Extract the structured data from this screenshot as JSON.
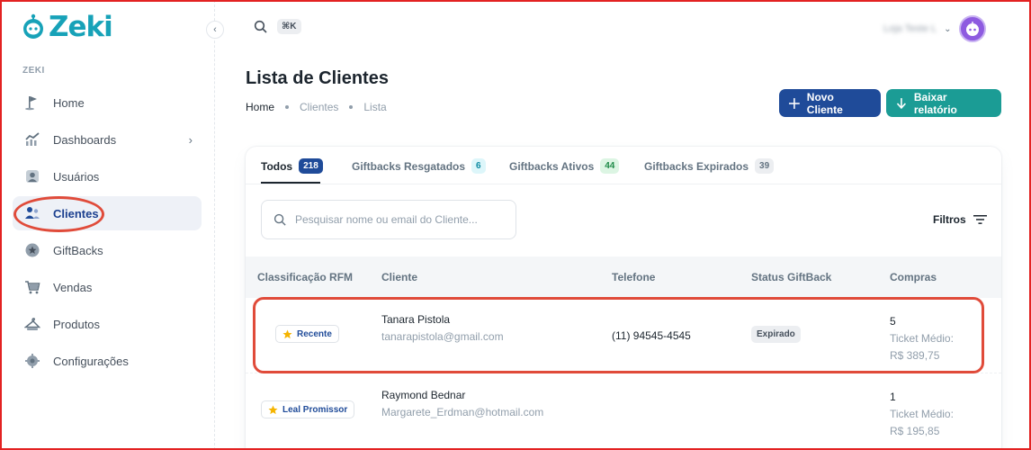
{
  "brand": {
    "name": "Zeki",
    "color": "#17a2b8"
  },
  "sidebar": {
    "section_label": "ZEKI",
    "items": [
      {
        "label": "Home",
        "icon": "flag-icon"
      },
      {
        "label": "Dashboards",
        "icon": "chart-line-icon"
      },
      {
        "label": "Usuários",
        "icon": "user-icon"
      },
      {
        "label": "Clientes",
        "icon": "clients-icon"
      },
      {
        "label": "GiftBacks",
        "icon": "star-badge-icon"
      },
      {
        "label": "Vendas",
        "icon": "cart-icon"
      },
      {
        "label": "Produtos",
        "icon": "hanger-icon"
      },
      {
        "label": "Configurações",
        "icon": "gear-icon"
      }
    ]
  },
  "header": {
    "search_shortcut": "⌘K",
    "account_name": "Loja Teste L"
  },
  "page": {
    "title": "Lista de Clientes",
    "breadcrumb": [
      "Home",
      "Clientes",
      "Lista"
    ],
    "buttons": {
      "new_client": "Novo Cliente",
      "download_report": "Baixar relatório"
    }
  },
  "tabs": [
    {
      "label": "Todos",
      "count": "218"
    },
    {
      "label": "Giftbacks Resgatados",
      "count": "6"
    },
    {
      "label": "Giftbacks Ativos",
      "count": "44"
    },
    {
      "label": "Giftbacks Expirados",
      "count": "39"
    }
  ],
  "search": {
    "placeholder": "Pesquisar nome ou email do Cliente..."
  },
  "filters_label": "Filtros",
  "table": {
    "columns": [
      "Classificação RFM",
      "Cliente",
      "Telefone",
      "Status GiftBack",
      "Compras"
    ],
    "rows": [
      {
        "rfm": "Recente",
        "name": "Tanara Pistola",
        "email": "tanarapistola@gmail.com",
        "phone": "(11) 94545-4545",
        "status": "Expirado",
        "purchases": "5",
        "ticket_label": "Ticket Médio:",
        "ticket_value": "R$ 389,75"
      },
      {
        "rfm": "Leal Promissor",
        "name": "Raymond Bednar",
        "email": "Margarete_Erdman@hotmail.com",
        "phone": "",
        "status": "",
        "purchases": "1",
        "ticket_label": "Ticket Médio:",
        "ticket_value": "R$ 195,85"
      }
    ]
  },
  "colors": {
    "primary": "#1f4b99",
    "teal": "#1b9c95",
    "annotation": "#e04b3a",
    "star": "#f5b400"
  }
}
